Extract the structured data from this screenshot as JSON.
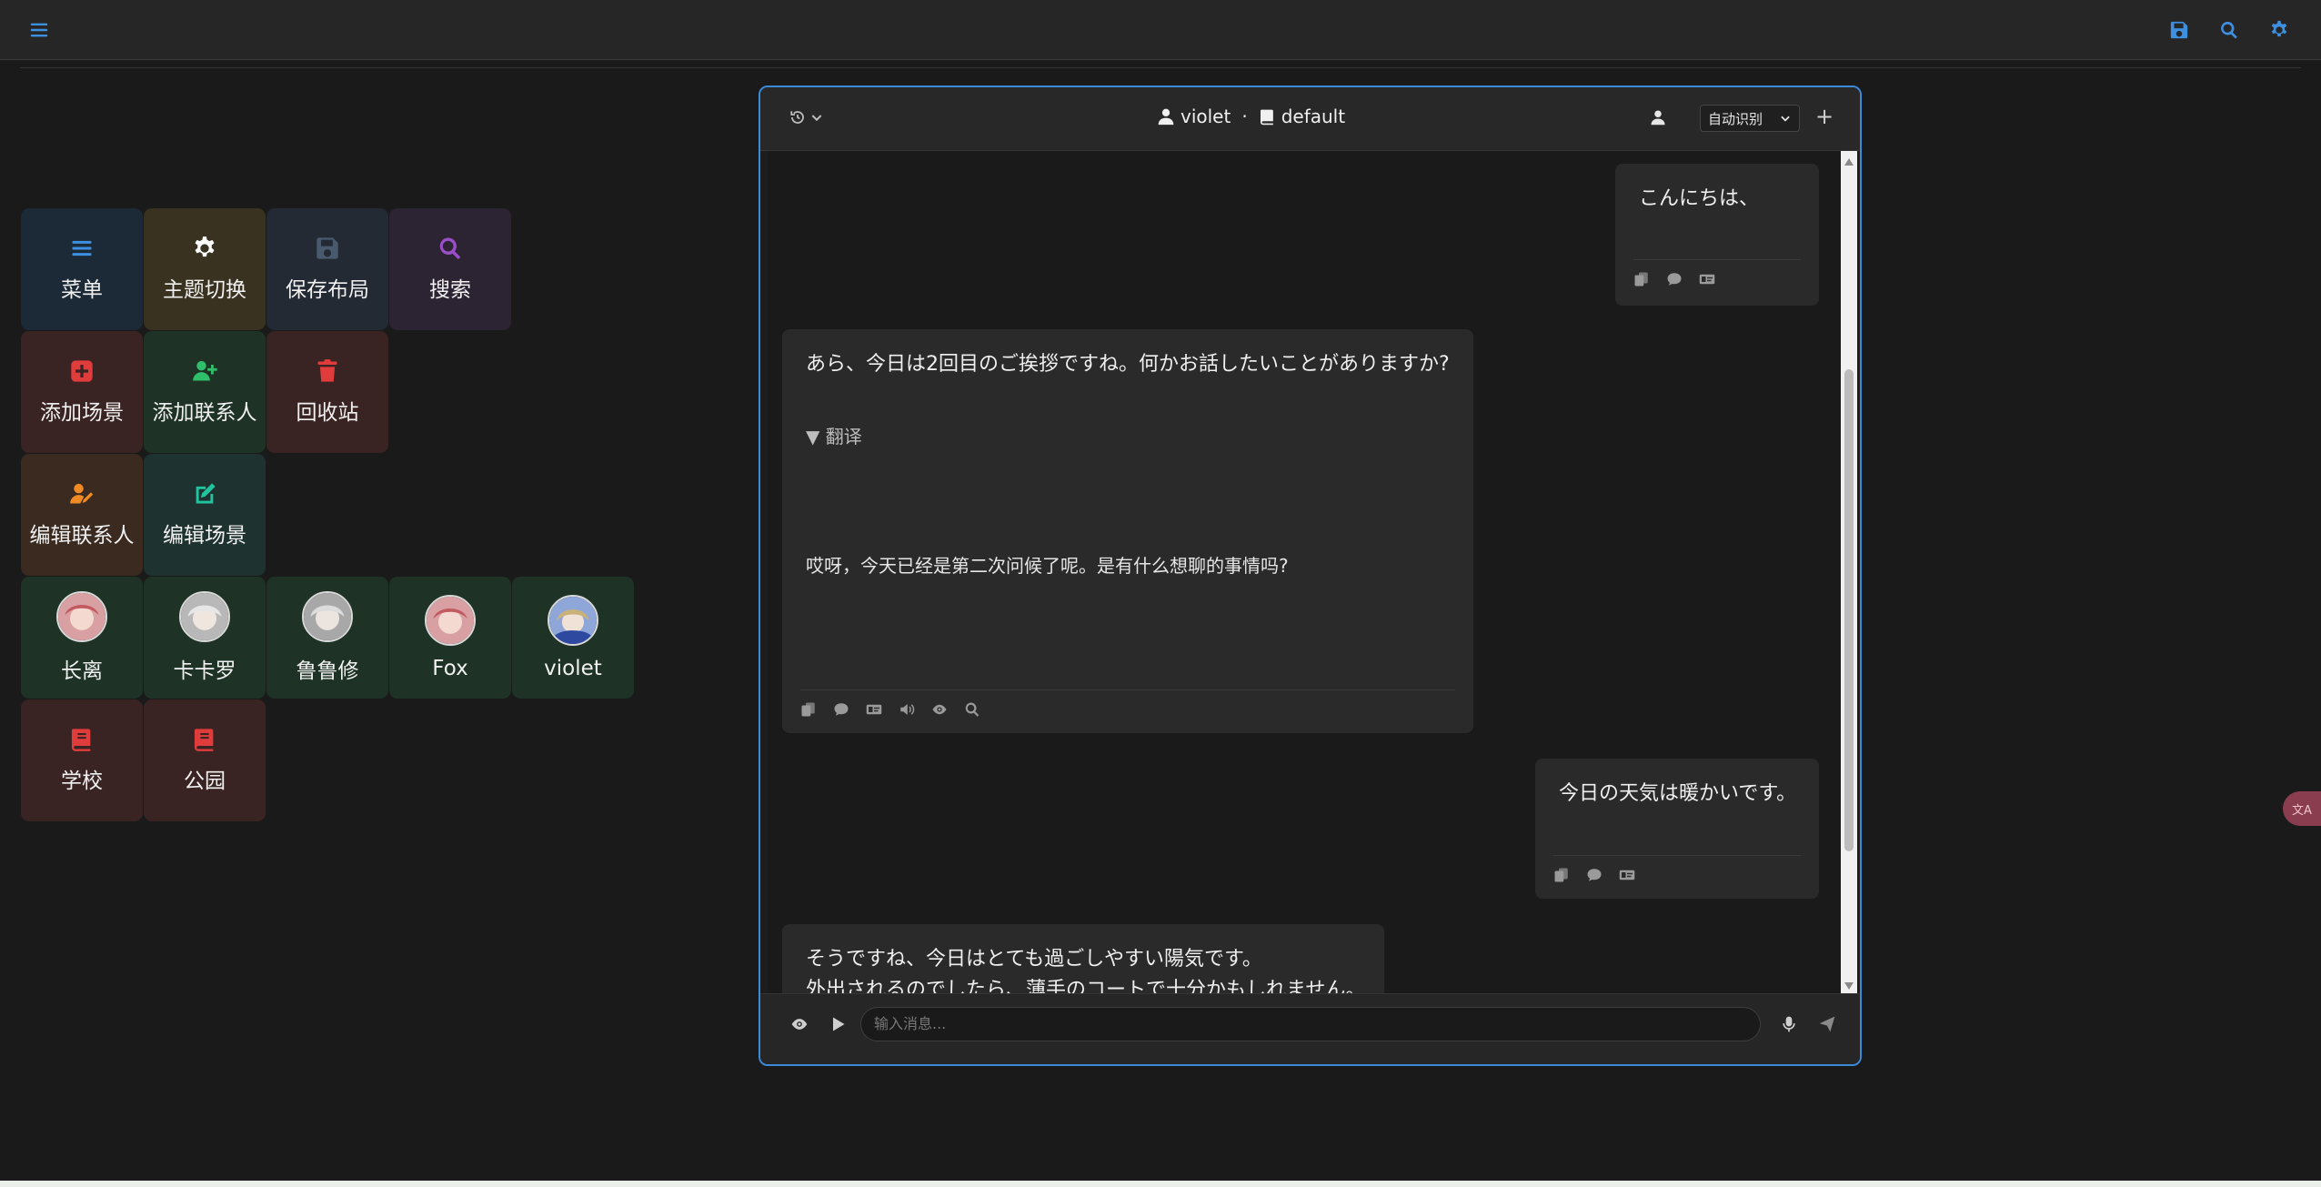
{
  "topbar": {
    "menu_icon": "hamburger-icon",
    "right_icons": [
      "save-icon",
      "search-icon",
      "gear-icon"
    ]
  },
  "tiles": {
    "menu": "菜单",
    "theme": "主题切换",
    "save_layout": "保存布局",
    "search": "搜索",
    "add_scene": "添加场景",
    "add_contact": "添加联系人",
    "recycle": "回收站",
    "edit_contact": "编辑联系人",
    "edit_scene": "编辑场景"
  },
  "contacts": [
    "长离",
    "卡卡罗",
    "鲁鲁修",
    "Fox",
    "violet"
  ],
  "scenes": [
    "学校",
    "公园"
  ],
  "chat": {
    "contact_name": "violet",
    "separator": "·",
    "scene_name": "default",
    "lang_select": "自动识别",
    "plus": "+",
    "messages": {
      "m1": "こんにちは、",
      "m2": "あら、今日は2回目のご挨拶ですね。何かお話したいことがありますか?",
      "m2_toggle": "▼ 翻译",
      "m2_translation": "哎呀，今天已经是第二次问候了呢。是有什么想聊的事情吗?",
      "m3": "今日の天気は暖かいです。",
      "m4_line1": "そうですね、今日はとても過ごしやすい陽気です。",
      "m4_line2": "外出されるのでしたら、薄手のコートで十分かもしれません。"
    },
    "input_placeholder": "输入消息..."
  },
  "float_badge": "文A"
}
